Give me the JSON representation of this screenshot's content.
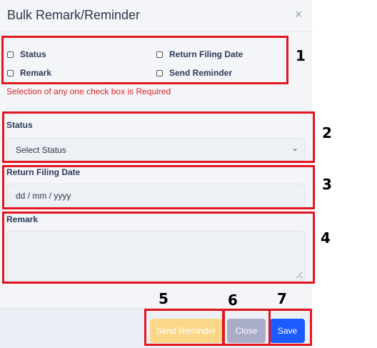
{
  "modal": {
    "title": "Bulk Remark/Reminder",
    "close_symbol": "×"
  },
  "checkboxes": [
    {
      "label": "Status",
      "checked": false
    },
    {
      "label": "Return Filing Date",
      "checked": false
    },
    {
      "label": "Remark",
      "checked": false
    },
    {
      "label": "Send Reminder",
      "checked": false
    }
  ],
  "validation_message": "Selection of any one check box is Required",
  "status_field": {
    "label": "Status",
    "selected": "Select Status"
  },
  "date_field": {
    "label": "Return Filing Date",
    "placeholder": "dd / mm / yyyy"
  },
  "remark_field": {
    "label": "Remark",
    "value": ""
  },
  "buttons": {
    "send_reminder": "Send Reminder",
    "close": "Close",
    "save": "Save"
  },
  "callouts": [
    "1",
    "2",
    "3",
    "4",
    "5",
    "6",
    "7"
  ],
  "colors": {
    "callout_red": "#e3161f",
    "error_red": "#e02424",
    "save_blue": "#1a5cff",
    "reminder_yellow": "#fbd78a",
    "close_gray": "#a9adc8"
  }
}
